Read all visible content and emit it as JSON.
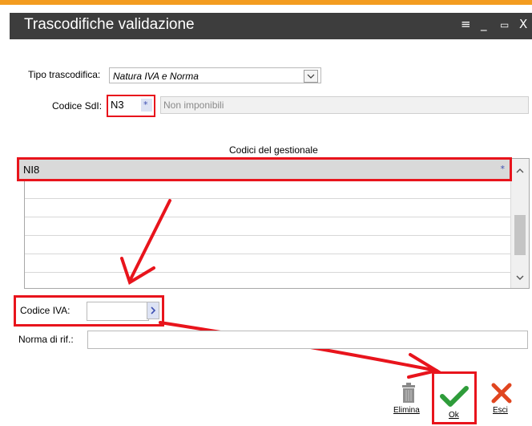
{
  "window": {
    "title": "Trascodifiche validazione",
    "controls": {
      "menu": "≡",
      "minimize": "_",
      "maximize": "▭",
      "close": "X"
    }
  },
  "form": {
    "tipo_label": "Tipo trascodifica:",
    "tipo_value": "Natura IVA e Norma",
    "codice_sdi_label": "Codice SdI:",
    "codice_sdi_value": "N3",
    "codice_sdi_desc": "Non imponibili",
    "grid_title": "Codici del gestionale",
    "grid_rows": [
      "NI8",
      "",
      "",
      "",
      "",
      "",
      ""
    ],
    "codice_iva_label": "Codice IVA:",
    "codice_iva_value": "",
    "norma_label": "Norma di rif.:",
    "norma_value": ""
  },
  "buttons": {
    "elimina": "Elimina",
    "ok": "Ok",
    "esci": "Esci"
  },
  "colors": {
    "annotation_red": "#e8141c",
    "accent_orange": "#f39c20",
    "titlebar": "#3d3d3d",
    "ok_green": "#2e9c3a",
    "close_red": "#e0451f"
  }
}
